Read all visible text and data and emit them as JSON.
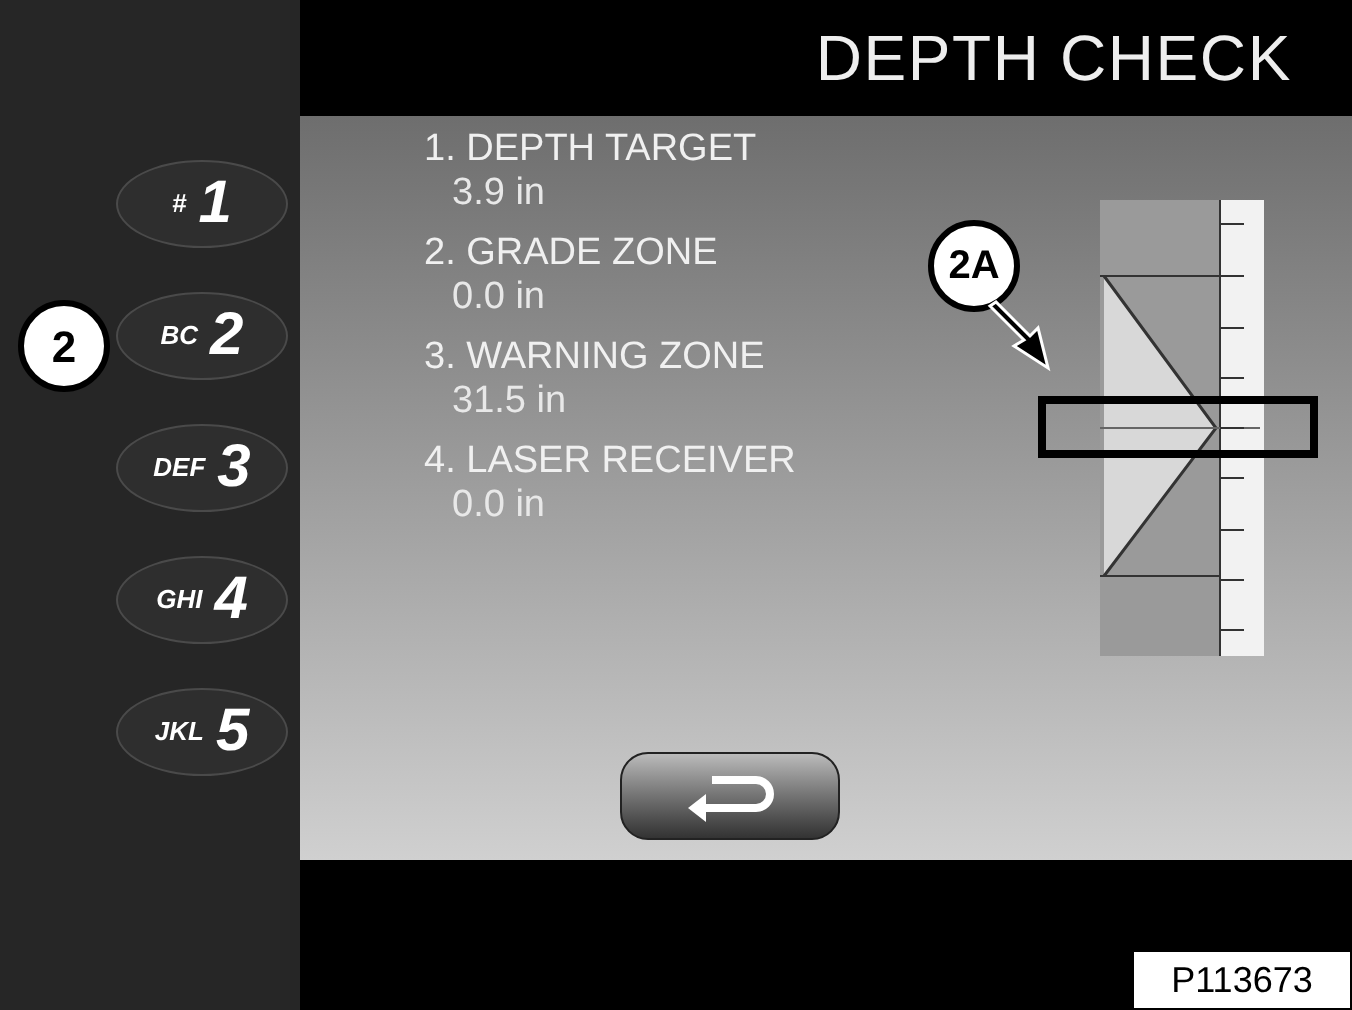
{
  "keypad": [
    {
      "letters": "#",
      "digit": "1"
    },
    {
      "letters": "BC",
      "digit": "2"
    },
    {
      "letters": "DEF",
      "digit": "3"
    },
    {
      "letters": "GHI",
      "digit": "4"
    },
    {
      "letters": "JKL",
      "digit": "5"
    }
  ],
  "screen": {
    "title": "DEPTH CHECK",
    "items": [
      {
        "label": "1. DEPTH TARGET",
        "value": "3.9 in"
      },
      {
        "label": "2. GRADE ZONE",
        "value": "0.0 in"
      },
      {
        "label": "3. WARNING ZONE",
        "value": "31.5 in"
      },
      {
        "label": "4. LASER RECEIVER",
        "value": "0.0 in"
      }
    ]
  },
  "callouts": [
    "2",
    "2A"
  ],
  "figure_id": "P113673"
}
